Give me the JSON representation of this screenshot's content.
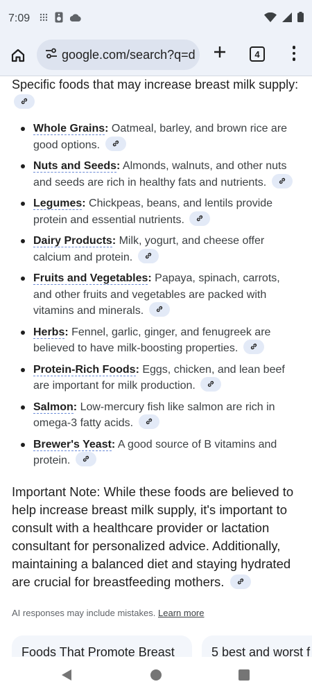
{
  "status_bar": {
    "time": "7:09"
  },
  "toolbar": {
    "url": "google.com/search?q=d",
    "tab_count": "4"
  },
  "content": {
    "intro": "Specific foods that may increase breast milk supply:",
    "foods": [
      {
        "term": "Whole Grains",
        "text": " Oatmeal, barley, and brown rice are good options."
      },
      {
        "term": "Nuts and Seeds",
        "text": " Almonds, walnuts, and other nuts and seeds are rich in healthy fats and nutrients."
      },
      {
        "term": "Legumes",
        "text": " Chickpeas, beans, and lentils provide protein and essential nutrients."
      },
      {
        "term": "Dairy Products",
        "text": " Milk, yogurt, and cheese offer calcium and protein."
      },
      {
        "term": "Fruits and Vegetables",
        "text": " Papaya, spinach, carrots, and other fruits and vegetables are packed with vitamins and minerals."
      },
      {
        "term": "Herbs",
        "text": " Fennel, garlic, ginger, and fenugreek are believed to have milk-boosting properties."
      },
      {
        "term": "Protein-Rich Foods",
        "text": " Eggs, chicken, and lean beef are important for milk production."
      },
      {
        "term": "Salmon",
        "text": " Low-mercury fish like salmon are rich in omega-3 fatty acids."
      },
      {
        "term": "Brewer's Yeast",
        "text": " A good source of B vitamins and protein."
      }
    ],
    "note": "Important Note: While these foods are believed to help increase breast milk supply, it's important to consult with a healthcare provider or lactation consultant for personalized advice. Additionally, maintaining a balanced diet and staying hydrated are crucial for breastfeeding mothers.",
    "disclaimer": "AI responses may include mistakes.",
    "learn_more": "Learn more",
    "cards": [
      "Foods That Promote Breast",
      "5 best and worst f"
    ]
  }
}
